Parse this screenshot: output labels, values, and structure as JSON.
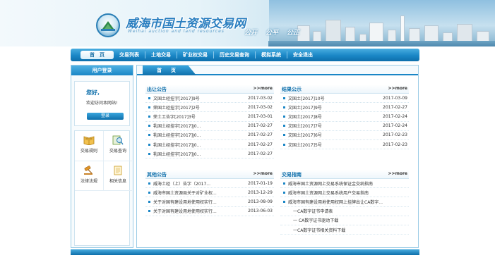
{
  "header": {
    "site_title": "威海市国土资源交易网",
    "site_subtitle": "Weihai auction and land resources",
    "slogans": [
      "公开",
      "公平",
      "公正"
    ]
  },
  "nav": {
    "items": [
      {
        "label": "首　页",
        "active": true
      },
      {
        "label": "交易列表"
      },
      {
        "label": "土地交易"
      },
      {
        "label": "矿业权交易"
      },
      {
        "label": "历史交易查询"
      },
      {
        "label": "模拟系统"
      },
      {
        "label": "安全退出"
      }
    ]
  },
  "sidebar": {
    "login_title": "用户登录",
    "greeting": "您好,",
    "welcome": "欢迎访问本网站!",
    "login_button": "登录",
    "quick_links": [
      {
        "label": "交易规则",
        "icon": "book-icon"
      },
      {
        "label": "交易查询",
        "icon": "magnifier-icon"
      },
      {
        "label": "法律法规",
        "icon": "gavel-icon"
      },
      {
        "label": "相关信息",
        "icon": "document-icon"
      }
    ]
  },
  "main": {
    "tab": "首　页",
    "panels": {
      "transfer": {
        "title": "出让公告",
        "more": ">>more",
        "rows": [
          {
            "text": "文国土经挂字[2017]9号",
            "date": "2017-03-02"
          },
          {
            "text": "荣国土经挂字[2017]2号",
            "date": "2017-03-02"
          },
          {
            "text": "荣土工告字[2017]3号",
            "date": "2017-03-01"
          },
          {
            "text": "乳国土经挂字[2017]J0...",
            "date": "2017-02-27"
          },
          {
            "text": "乳国土经挂字[2017]J0...",
            "date": "2017-02-27"
          },
          {
            "text": "乳国土经挂字[2017]J0...",
            "date": "2017-02-27"
          },
          {
            "text": "乳国土经挂字[2017]J0...",
            "date": "2017-02-27"
          }
        ]
      },
      "results": {
        "title": "结果公示",
        "more": ">>more",
        "rows": [
          {
            "text": "文国土[2017]10号",
            "date": "2017-03-09"
          },
          {
            "text": "文国土[2017]9号",
            "date": "2017-02-27"
          },
          {
            "text": "文国土[2017]8号",
            "date": "2017-02-24"
          },
          {
            "text": "文国土[2017]7号",
            "date": "2017-02-24"
          },
          {
            "text": "文国土[2017]6号",
            "date": "2017-02-23"
          },
          {
            "text": "文国土[2017]5号",
            "date": "2017-02-23"
          }
        ]
      },
      "other": {
        "title": "其他公告",
        "more": ">>more",
        "rows": [
          {
            "text": "威海土经（上）告字（2017...",
            "date": "2017-01-19"
          },
          {
            "text": "威海市国土资源局关于对矿业权...",
            "date": "2013-12-29"
          },
          {
            "text": "关于对国有建设用地使用权实行...",
            "date": "2013-08-09"
          },
          {
            "text": "关于对国有建设用地使用权实行...",
            "date": "2013-06-03"
          }
        ]
      },
      "guide": {
        "title": "交易指南",
        "more": ">>more",
        "rows": [
          {
            "text": "威海市国土资源网上交易系统保证金交纳指南"
          },
          {
            "text": "威海市国土资源网上交易系统用户交易指南"
          },
          {
            "text": "威海市国有建设用地使用权网上挂牌出让CA数字..."
          },
          {
            "text": "一CA数字证书申请表",
            "indent": true
          },
          {
            "text": "一 CA数字证书驱动下载",
            "indent": true
          },
          {
            "text": "一CA数字证书相关资料下载",
            "indent": true
          }
        ]
      }
    }
  }
}
